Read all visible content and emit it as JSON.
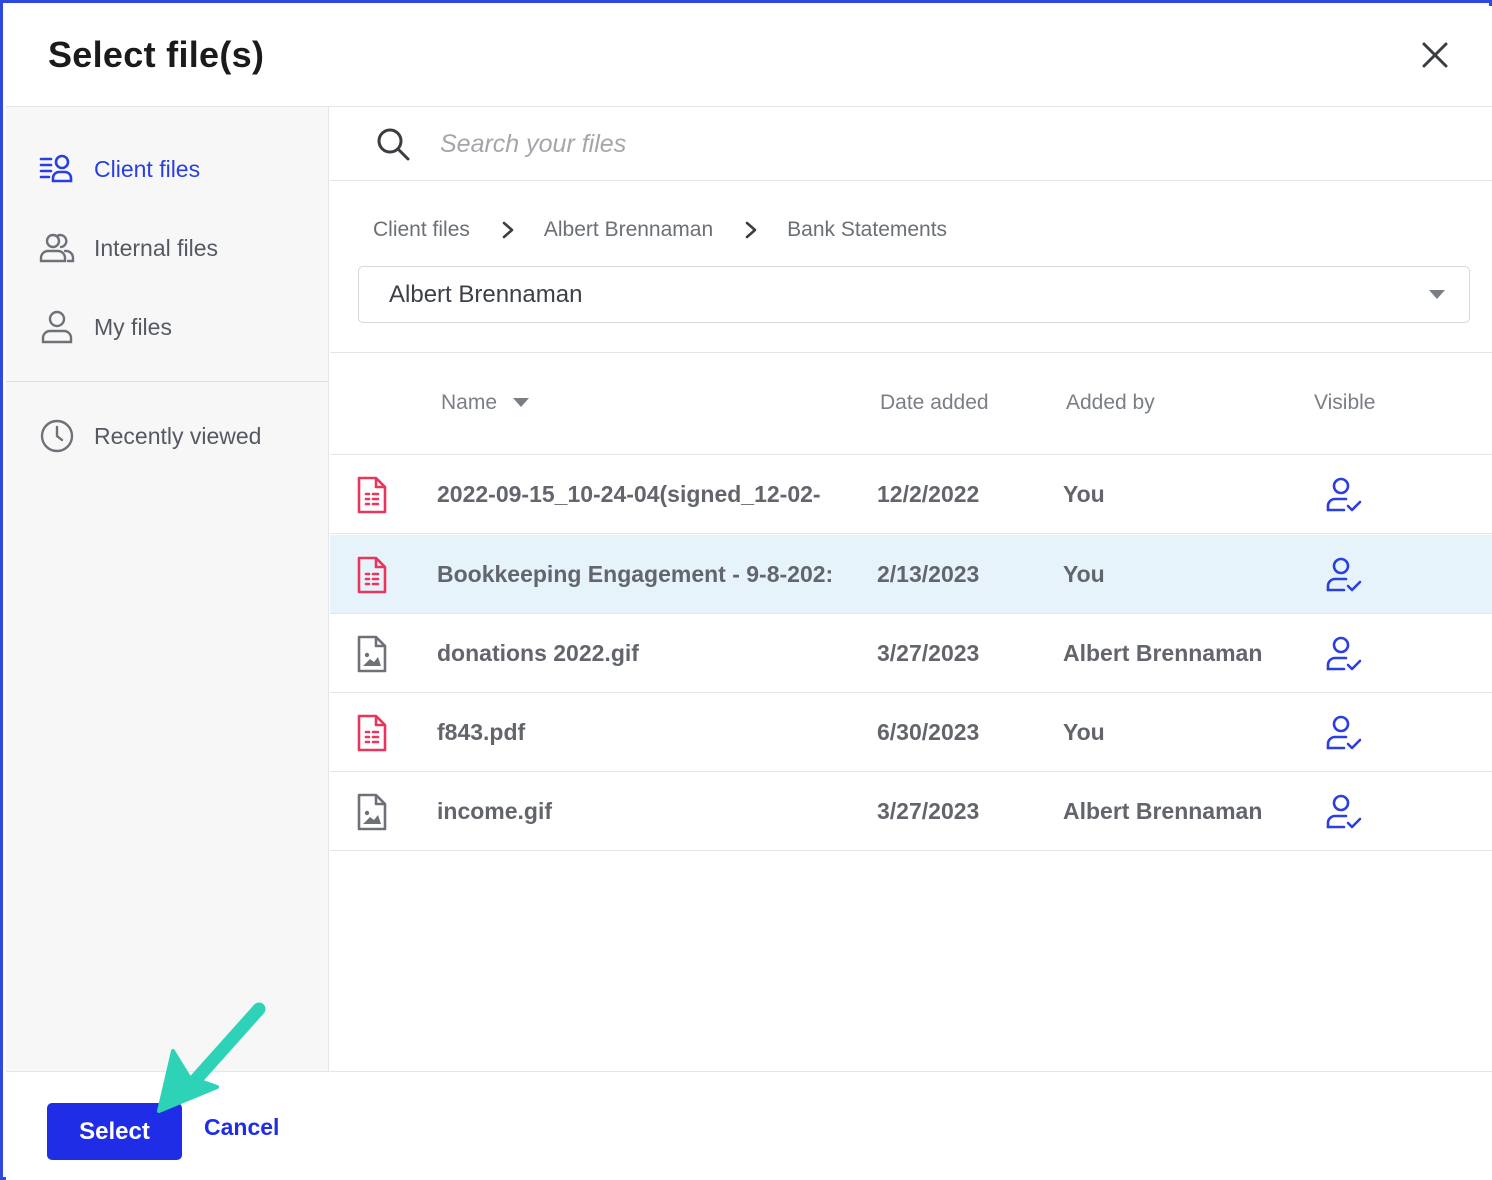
{
  "dialog": {
    "title": "Select file(s)"
  },
  "sidebar": {
    "items": [
      {
        "label": "Client files",
        "icon": "client-files-icon",
        "active": true
      },
      {
        "label": "Internal files",
        "icon": "users-icon",
        "active": false
      },
      {
        "label": "My files",
        "icon": "user-icon",
        "active": false
      },
      {
        "label": "Recently viewed",
        "icon": "clock-icon",
        "active": false
      }
    ]
  },
  "search": {
    "placeholder": "Search your files",
    "value": ""
  },
  "breadcrumb": [
    "Client files",
    "Albert Brennaman",
    "Bank Statements"
  ],
  "client_select": {
    "value": "Albert Brennaman"
  },
  "table": {
    "columns": [
      "Name",
      "Date added",
      "Added by",
      "Visible"
    ],
    "rows": [
      {
        "name": "2022-09-15_10-24-04(signed_12-02-",
        "date": "12/2/2022",
        "added_by": "You",
        "type": "pdf-icon",
        "visible": "user-check-icon",
        "selected": false
      },
      {
        "name": "Bookkeeping Engagement - 9-8-202:",
        "date": "2/13/2023",
        "added_by": "You",
        "type": "pdf-icon",
        "visible": "user-check-icon",
        "selected": true
      },
      {
        "name": "donations 2022.gif",
        "date": "3/27/2023",
        "added_by": "Albert Brennaman",
        "type": "image-file-icon",
        "visible": "user-check-icon",
        "selected": false
      },
      {
        "name": "f843.pdf",
        "date": "6/30/2023",
        "added_by": "You",
        "type": "pdf-icon",
        "visible": "user-check-icon",
        "selected": false
      },
      {
        "name": "income.gif",
        "date": "3/27/2023",
        "added_by": "Albert Brennaman",
        "type": "image-file-icon",
        "visible": "user-check-icon",
        "selected": false
      }
    ]
  },
  "footer": {
    "select_label": "Select",
    "cancel_label": "Cancel"
  },
  "colors": {
    "accent": "#1f2ee6",
    "pdf": "#e8365d",
    "selected_row": "#e7f3fb",
    "annotation_arrow": "#2ed3b7"
  }
}
